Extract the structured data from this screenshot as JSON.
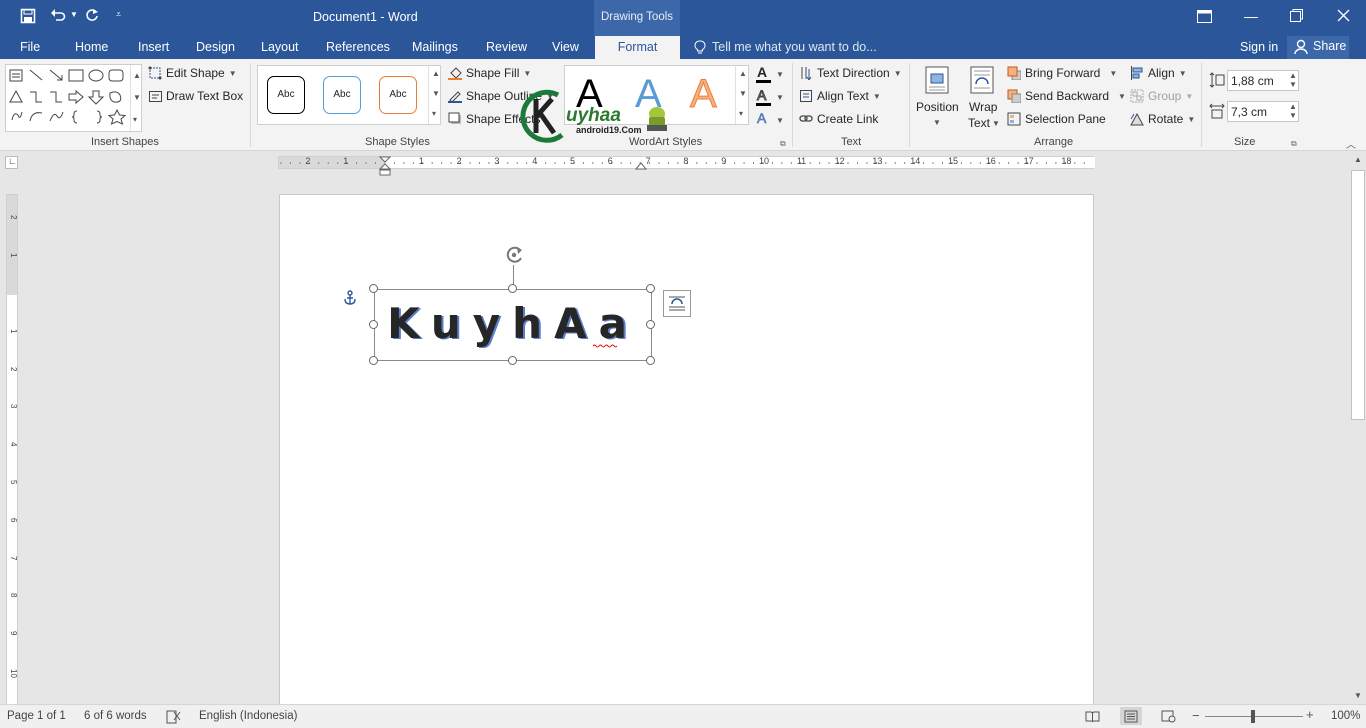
{
  "window": {
    "title": "Document1 - Word",
    "context_tab_group": "Drawing Tools",
    "tell_me": "Tell me what you want to do...",
    "sign_in": "Sign in",
    "share": "Share"
  },
  "tabs": [
    "File",
    "Home",
    "Insert",
    "Design",
    "Layout",
    "References",
    "Mailings",
    "Review",
    "View",
    "Format"
  ],
  "active_tab": "Format",
  "ribbon": {
    "insert_shapes": {
      "label": "Insert Shapes",
      "edit_shape": "Edit Shape",
      "draw_text_box": "Draw Text Box"
    },
    "shape_styles": {
      "label": "Shape Styles",
      "preview": "Abc",
      "fill": "Shape Fill",
      "outline": "Shape Outline",
      "effects": "Shape Effects"
    },
    "wordart_styles": {
      "label": "WordArt Styles",
      "letter": "A"
    },
    "text": {
      "label": "Text",
      "direction": "Text Direction",
      "align": "Align Text",
      "link": "Create Link"
    },
    "arrange": {
      "label": "Arrange",
      "position": "Position",
      "wrap_1": "Wrap",
      "wrap_2": "Text",
      "bring_forward": "Bring Forward",
      "send_backward": "Send Backward",
      "selection_pane": "Selection Pane",
      "align": "Align",
      "group": "Group",
      "rotate": "Rotate"
    },
    "size": {
      "label": "Size",
      "height": "1,88 cm",
      "width": "7,3 cm"
    }
  },
  "ruler": {
    "h_ticks": [
      "2",
      "1",
      "1",
      "2",
      "3",
      "4",
      "5",
      "6",
      "7",
      "8",
      "9",
      "10",
      "11",
      "12",
      "13",
      "14",
      "15",
      "16",
      "17",
      "18"
    ],
    "v_ticks": [
      "2",
      "1",
      "1",
      "2",
      "3",
      "4",
      "5",
      "6",
      "7",
      "8",
      "9",
      "10"
    ]
  },
  "document": {
    "wordart_text": "KuyhAa"
  },
  "watermark": {
    "brand": "uyhaa",
    "site": "android19.Com"
  },
  "status": {
    "page": "Page 1 of 1",
    "words": "6 of 6 words",
    "language": "English (Indonesia)",
    "zoom": "100%"
  },
  "colors": {
    "accent": "#2b579a",
    "ribbon": "#f3f3f3",
    "canvas": "#e6e6e6",
    "font_color_bar": "#000000"
  }
}
